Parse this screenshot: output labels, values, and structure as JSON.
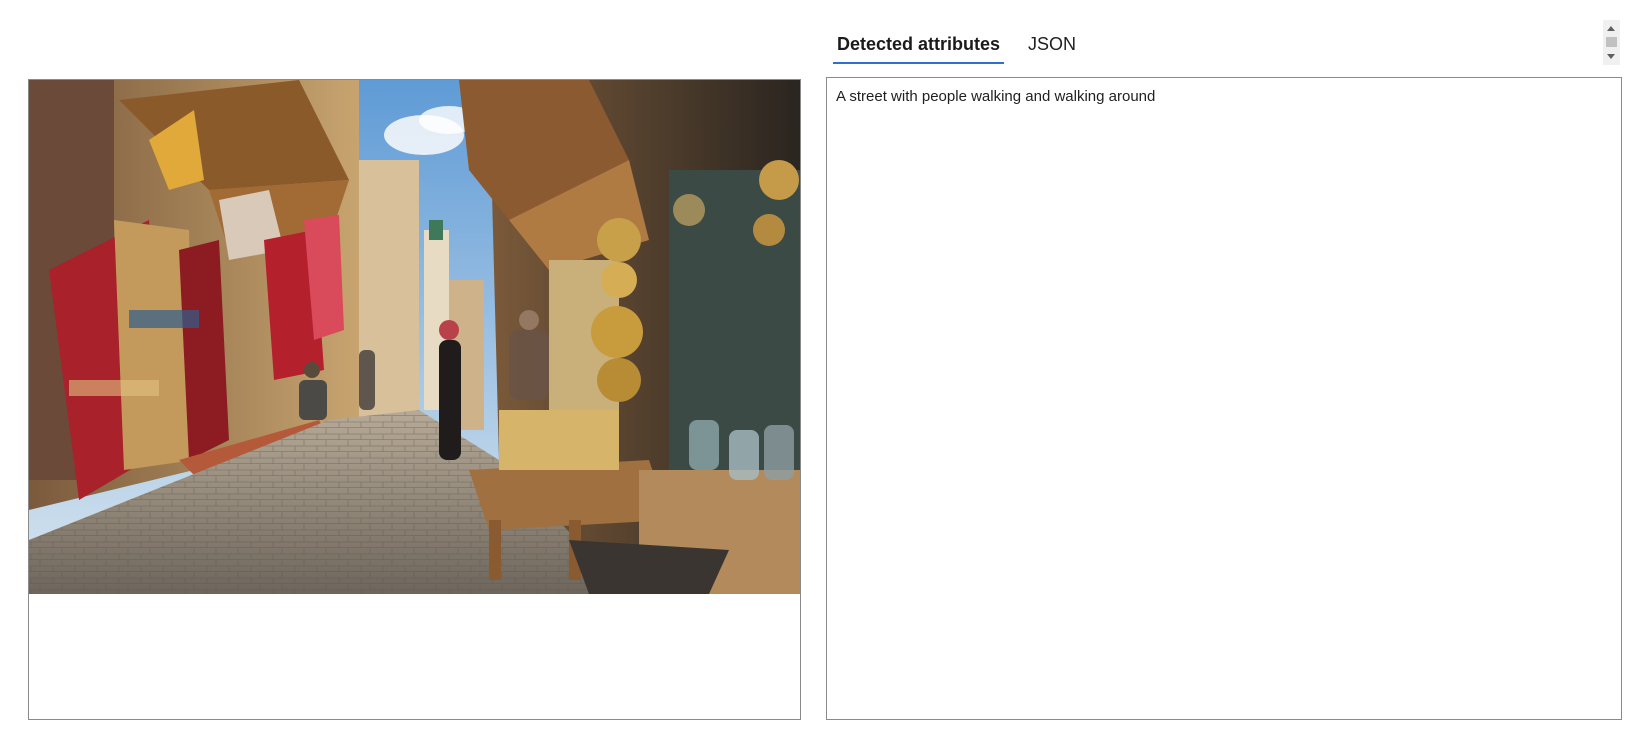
{
  "tabs": [
    {
      "label": "Detected attributes",
      "active": true
    },
    {
      "label": "JSON",
      "active": false
    }
  ],
  "results": {
    "caption": "A street with people walking and walking around"
  },
  "colors": {
    "tab_underline": "#2f6fd1",
    "panel_border": "#8a8a8a"
  }
}
